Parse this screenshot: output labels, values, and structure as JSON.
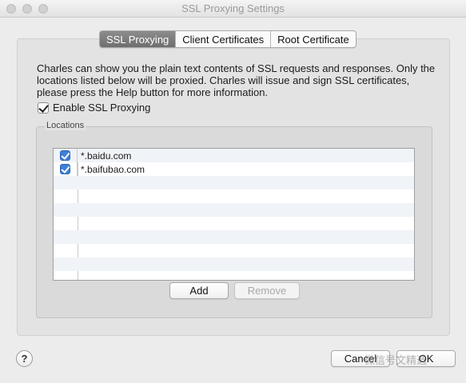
{
  "window": {
    "title": "SSL Proxying Settings"
  },
  "tabs": [
    {
      "label": "SSL Proxying",
      "active": true
    },
    {
      "label": "Client Certificates",
      "active": false
    },
    {
      "label": "Root Certificate",
      "active": false
    }
  ],
  "description": "Charles can show you the plain text contents of SSL requests and responses. Only the locations listed below will be proxied. Charles will issue and sign SSL certificates, please press the Help button for more information.",
  "enable_ssl": {
    "label": "Enable SSL Proxying",
    "checked": true
  },
  "locations": {
    "label": "Locations",
    "items": [
      {
        "host": "*.baidu.com",
        "checked": true
      },
      {
        "host": "*.baifubao.com",
        "checked": true
      }
    ]
  },
  "buttons": {
    "add": "Add",
    "remove": "Remove",
    "help": "?",
    "cancel": "Cancel",
    "ok": "OK"
  },
  "watermark": "微信号文精选",
  "colors": {
    "accent_check": "#3e7fd6",
    "active_tab": "#7d7d7d"
  }
}
